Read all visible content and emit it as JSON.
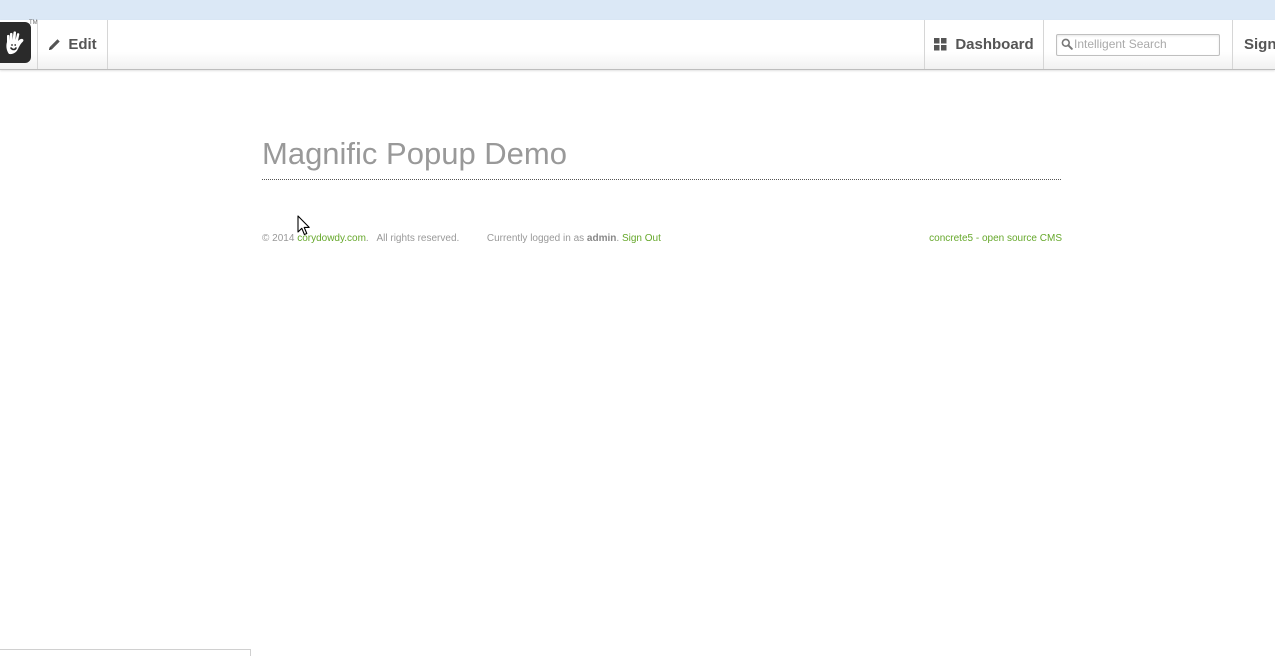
{
  "toolbar": {
    "edit_label": "Edit",
    "dashboard_label": "Dashboard",
    "search_placeholder": "Intelligent Search",
    "sign_label": "Sign",
    "logo_tm": "TM"
  },
  "page": {
    "title": "Magnific Popup Demo"
  },
  "footer": {
    "copyright": "© 2014",
    "site_link": "corydowdy.com",
    "rights": ".   All rights reserved.",
    "logged_in_prefix": "Currently logged in as",
    "username": "admin",
    "signout_label": "Sign Out",
    "cms_link": "concrete5 - open source CMS"
  },
  "colors": {
    "accent_link": "#66a82b",
    "title_gray": "#999999",
    "top_strip": "#dbe8f6"
  }
}
